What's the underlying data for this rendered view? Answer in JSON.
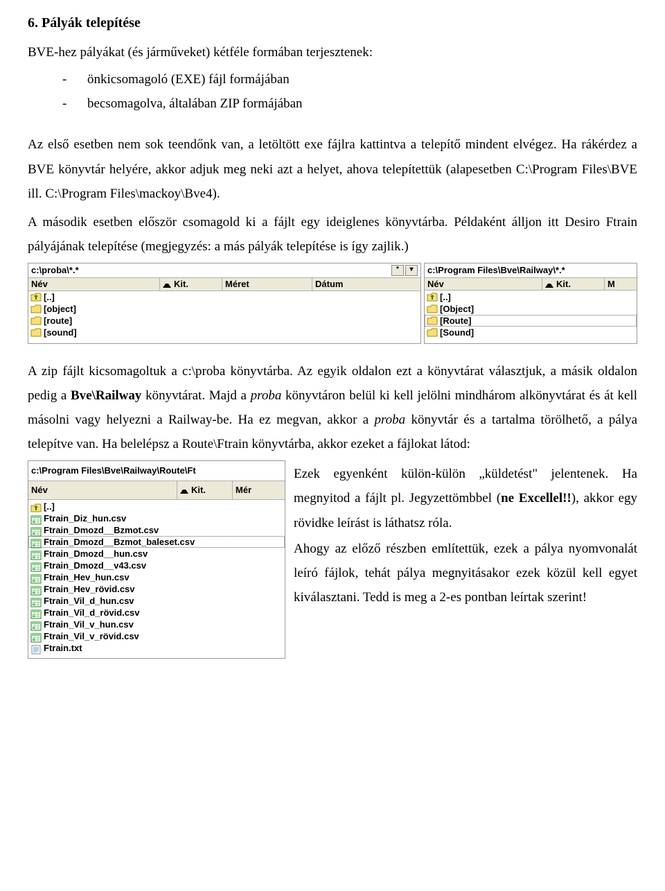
{
  "heading": "6. Pályák telepítése",
  "intro": "BVE-hez pályákat (és járműveket) kétféle formában terjesztenek:",
  "bullets": [
    "önkicsomagoló (EXE) fájl formájában",
    "becsomagolva, általában ZIP formájában"
  ],
  "para1": "Az első esetben nem sok teendőnk van, a letöltött exe fájlra kattintva a telepítő mindent elvégez. Ha rákérdez a BVE könyvtár helyére, akkor adjuk meg neki azt a helyet, ahova telepítettük (alapesetben C:\\Program Files\\BVE ill. C:\\Program Files\\mackoy\\Bve4).",
  "para2": "A második esetben először csomagold ki a fájlt egy ideiglenes könyvtárba. Példaként álljon itt Desiro Ftrain pályájának telepítése (megjegyzés: a más pályák telepítése is így zajlik.)",
  "panel_left": {
    "path": "c:\\proba\\*.*",
    "cols": {
      "name": "Név",
      "ext": "Kit.",
      "size": "Méret",
      "date": "Dátum"
    },
    "items": [
      {
        "type": "updir",
        "label": "[..]"
      },
      {
        "type": "folder",
        "label": "[object]"
      },
      {
        "type": "folder",
        "label": "[route]"
      },
      {
        "type": "folder",
        "label": "[sound]"
      }
    ]
  },
  "panel_right": {
    "path": "c:\\Program Files\\Bve\\Railway\\*.*",
    "cols": {
      "name": "Név",
      "ext": "Kit.",
      "last": "M"
    },
    "items": [
      {
        "type": "updir",
        "label": "[..]"
      },
      {
        "type": "folder",
        "label": "[Object]"
      },
      {
        "type": "folder",
        "label": "[Route]",
        "selected": true
      },
      {
        "type": "folder",
        "label": "[Sound]"
      }
    ]
  },
  "mid_para_parts": {
    "t1": "A zip fájlt kicsomagoltuk a c:\\proba könyvtárba. Az egyik oldalon ezt a könyvtárat választjuk, a másik oldalon pedig a ",
    "b1": "Bve\\Railway",
    "t2": " könyvtárat. Majd a ",
    "i1": "proba",
    "t3": " könyvtáron belül ki kell jelölni mindhárom alkönyvtárat és át kell másolni vagy helyezni a Railway-be. Ha ez megvan, akkor a ",
    "i2": "proba",
    "t4": " könyvtár és a tartalma törölhető, a pálya telepítve van. Ha belelépsz a Route\\Ftrain könyvtárba, akkor ezeket a fájlokat látod:"
  },
  "bottom_panel": {
    "path": "c:\\Program Files\\Bve\\Railway\\Route\\Ft",
    "cols": {
      "name": "Név",
      "ext": "Kit.",
      "size": "Mér"
    },
    "items": [
      {
        "type": "updir",
        "label": "[..]"
      },
      {
        "type": "csv",
        "label": "Ftrain_Diz_hun.csv"
      },
      {
        "type": "csv",
        "label": "Ftrain_Dmozd__Bzmot.csv"
      },
      {
        "type": "csv",
        "label": "Ftrain_Dmozd__Bzmot_baleset.csv",
        "selected": true
      },
      {
        "type": "csv",
        "label": "Ftrain_Dmozd__hun.csv"
      },
      {
        "type": "csv",
        "label": "Ftrain_Dmozd__v43.csv"
      },
      {
        "type": "csv",
        "label": "Ftrain_Hev_hun.csv"
      },
      {
        "type": "csv",
        "label": "Ftrain_Hev_rövid.csv"
      },
      {
        "type": "csv",
        "label": "Ftrain_Vil_d_hun.csv"
      },
      {
        "type": "csv",
        "label": "Ftrain_Vil_d_rövid.csv"
      },
      {
        "type": "csv",
        "label": "Ftrain_Vil_v_hun.csv"
      },
      {
        "type": "csv",
        "label": "Ftrain_Vil_v_rövid.csv"
      },
      {
        "type": "txt",
        "label": "Ftrain.txt"
      }
    ]
  },
  "bottom_text": {
    "p1a": "Ezek egyenként külön-külön „küldetést\" jelentenek. Ha megnyitod a fájlt pl. Jegyzettömbbel (",
    "p1b": "ne Excellel!!",
    "p1c": "), akkor egy rövidke leírást is láthatsz róla.",
    "p2": "Ahogy az előző részben említettük, ezek a pálya nyomvonalát leíró fájlok, tehát pálya megnyitásakor ezek közül kell egyet kiválasztani. Tedd is meg a 2-es pontban leírtak szerint!"
  }
}
